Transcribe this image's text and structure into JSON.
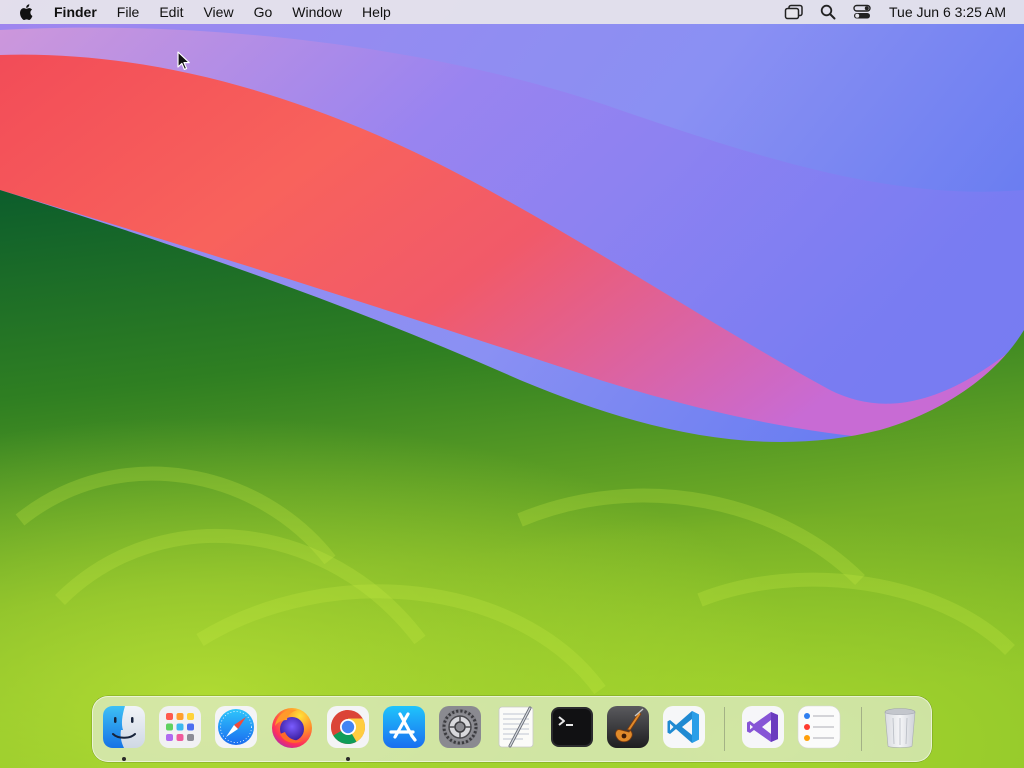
{
  "menubar": {
    "apple_icon": "apple-logo-icon",
    "app_name": "Finder",
    "items": [
      "File",
      "Edit",
      "View",
      "Go",
      "Window",
      "Help"
    ],
    "status_icons": [
      "screen-mirroring-icon",
      "spotlight-search-icon",
      "control-center-icon"
    ],
    "clock": "Tue Jun 6  3:25 AM"
  },
  "dock": {
    "apps": [
      {
        "name": "Finder",
        "icon": "finder-icon",
        "running": true
      },
      {
        "name": "Launchpad",
        "icon": "launchpad-icon",
        "running": false
      },
      {
        "name": "Safari",
        "icon": "safari-icon",
        "running": false
      },
      {
        "name": "Firefox",
        "icon": "firefox-icon",
        "running": false
      },
      {
        "name": "Google Chrome",
        "icon": "chrome-icon",
        "running": true
      },
      {
        "name": "App Store",
        "icon": "app-store-icon",
        "running": false
      },
      {
        "name": "System Settings",
        "icon": "system-settings-icon",
        "running": false
      },
      {
        "name": "TextEdit",
        "icon": "textedit-icon",
        "running": false
      },
      {
        "name": "Terminal",
        "icon": "terminal-icon",
        "running": false
      },
      {
        "name": "GarageBand",
        "icon": "garageband-icon",
        "running": false
      },
      {
        "name": "Visual Studio Code",
        "icon": "vscode-icon",
        "running": false
      }
    ],
    "recent_apps": [
      {
        "name": "Visual Studio",
        "icon": "visual-studio-icon",
        "running": false
      },
      {
        "name": "Reminders",
        "icon": "reminders-icon",
        "running": false
      }
    ],
    "trash": {
      "name": "Trash",
      "icon": "trash-icon"
    }
  },
  "colors": {
    "menubar_bg": "#e8e6ec",
    "wallpaper_green": "#3f8a1f",
    "wallpaper_red": "#f45a5e",
    "wallpaper_blue": "#7f86f5"
  }
}
